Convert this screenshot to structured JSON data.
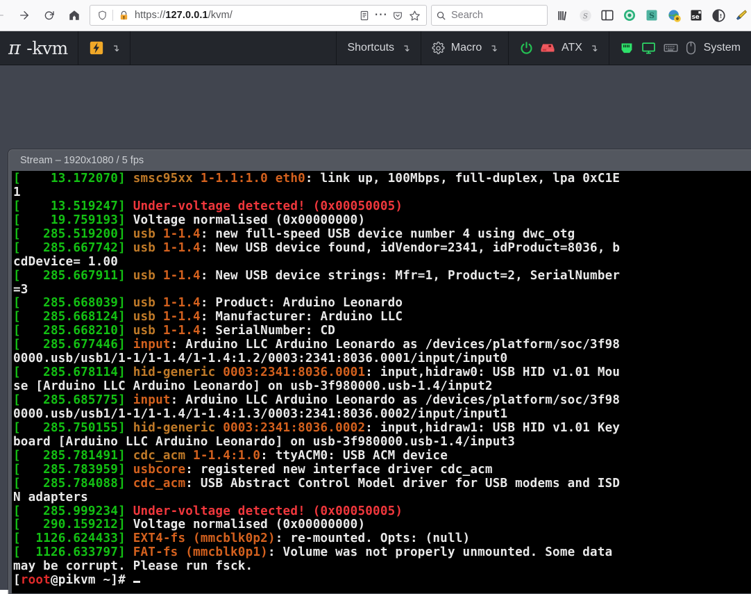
{
  "browser": {
    "nav": {
      "back_icon": "arrow-left-icon",
      "forward_icon": "arrow-right-icon",
      "reload_icon": "reload-icon",
      "home_icon": "home-icon"
    },
    "urlbar": {
      "shield_icon": "shield-icon",
      "lock_warning_icon": "lock-warning-icon",
      "url_prefix": "https://",
      "url_host": "127.0.0.1",
      "url_path": "/kvm/",
      "url_full": "https://127.0.0.1/kvm/",
      "reader_icon": "reader-view-icon",
      "page_actions_icon": "ellipsis-icon",
      "pocket_icon": "pocket-icon",
      "bookmark_icon": "star-icon"
    },
    "search": {
      "icon": "search-icon",
      "placeholder": "Search"
    },
    "extensions": [
      {
        "name": "library-icon",
        "label": ""
      },
      {
        "name": "sidebery-icon",
        "label": "S"
      },
      {
        "name": "sidebar-toggle-icon",
        "label": ""
      },
      {
        "name": "privacy-badger-icon",
        "label": ""
      },
      {
        "name": "stylus-icon",
        "label": "S"
      },
      {
        "name": "globe-extension-icon",
        "label": ""
      },
      {
        "name": "selenium-icon",
        "label": "se"
      },
      {
        "name": "noscript-icon",
        "label": ""
      },
      {
        "name": "highlighter-icon",
        "label": ""
      }
    ]
  },
  "pikvm": {
    "logo": {
      "pi": "π",
      "rest": "-kvm"
    },
    "menu": {
      "bolt": {
        "icon": "bolt-icon",
        "caret": "↴"
      },
      "shortcuts": {
        "label": "Shortcuts",
        "caret": "↴"
      },
      "macro": {
        "icon": "gear-icon",
        "label": "Macro",
        "caret": "↴"
      },
      "atx": {
        "power_icon": "power-icon",
        "hdd_icon": "hdd-icon",
        "label": "ATX",
        "caret": "↴"
      },
      "system": {
        "net_icon": "network-jack-icon",
        "video_icon": "monitor-icon",
        "keyboard_icon": "keyboard-icon",
        "mouse_icon": "mouse-icon",
        "label": "System"
      }
    },
    "colors": {
      "header_bg": "#23262c",
      "app_bg": "#41454f",
      "led_on": "#2ee06a",
      "led_off": "#7b7f86",
      "power_green": "#24c254",
      "hdd_red": "#f0585e"
    },
    "stream": {
      "title": "Stream – 1920x1080 / 5 fps",
      "resolution": "1920x1080",
      "fps": "5 fps"
    }
  },
  "terminal": {
    "lines": [
      [
        {
          "t": "[    13.172070] ",
          "c": "c-green"
        },
        {
          "t": "smsc95xx ",
          "c": "c-orange"
        },
        {
          "t": "1-1.1:1.0 eth0",
          "c": "c-amber"
        },
        {
          "t": ": link up, 100Mbps, full-duplex, lpa 0xC1E",
          "c": "c-white"
        }
      ],
      [
        {
          "t": "1",
          "c": "c-white"
        }
      ],
      [
        {
          "t": "[    13.519247] ",
          "c": "c-green"
        },
        {
          "t": "Under-voltage detected! (0x00050005)",
          "c": "c-red"
        }
      ],
      [
        {
          "t": "[    19.759193] ",
          "c": "c-green"
        },
        {
          "t": "Voltage normalised (0x00000000)",
          "c": "c-white"
        }
      ],
      [
        {
          "t": "[   285.519200] ",
          "c": "c-green"
        },
        {
          "t": "usb ",
          "c": "c-orange"
        },
        {
          "t": "1-1.4",
          "c": "c-amber"
        },
        {
          "t": ": new full-speed USB device number 4 using dwc_otg",
          "c": "c-white"
        }
      ],
      [
        {
          "t": "[   285.667742] ",
          "c": "c-green"
        },
        {
          "t": "usb ",
          "c": "c-orange"
        },
        {
          "t": "1-1.4",
          "c": "c-amber"
        },
        {
          "t": ": New USB device found, idVendor=2341, idProduct=8036, b",
          "c": "c-white"
        }
      ],
      [
        {
          "t": "cdDevice= 1.00",
          "c": "c-white"
        }
      ],
      [
        {
          "t": "[   285.667911] ",
          "c": "c-green"
        },
        {
          "t": "usb ",
          "c": "c-orange"
        },
        {
          "t": "1-1.4",
          "c": "c-amber"
        },
        {
          "t": ": New USB device strings: Mfr=1, Product=2, SerialNumber",
          "c": "c-white"
        }
      ],
      [
        {
          "t": "=3",
          "c": "c-white"
        }
      ],
      [
        {
          "t": "[   285.668039] ",
          "c": "c-green"
        },
        {
          "t": "usb ",
          "c": "c-orange"
        },
        {
          "t": "1-1.4",
          "c": "c-amber"
        },
        {
          "t": ": Product: Arduino Leonardo",
          "c": "c-white"
        }
      ],
      [
        {
          "t": "[   285.668124] ",
          "c": "c-green"
        },
        {
          "t": "usb ",
          "c": "c-orange"
        },
        {
          "t": "1-1.4",
          "c": "c-amber"
        },
        {
          "t": ": Manufacturer: Arduino LLC",
          "c": "c-white"
        }
      ],
      [
        {
          "t": "[   285.668210] ",
          "c": "c-green"
        },
        {
          "t": "usb ",
          "c": "c-orange"
        },
        {
          "t": "1-1.4",
          "c": "c-amber"
        },
        {
          "t": ": SerialNumber: CD",
          "c": "c-white"
        }
      ],
      [
        {
          "t": "[   285.677446] ",
          "c": "c-green"
        },
        {
          "t": "input",
          "c": "c-amber"
        },
        {
          "t": ": Arduino LLC Arduino Leonardo as /devices/platform/soc/3f98",
          "c": "c-white"
        }
      ],
      [
        {
          "t": "0000.usb/usb1/1-1/1-1.4/1-1.4:1.2/0003:2341:8036.0001/input/input0",
          "c": "c-white"
        }
      ],
      [
        {
          "t": "[   285.678114] ",
          "c": "c-green"
        },
        {
          "t": "hid-generic ",
          "c": "c-orange"
        },
        {
          "t": "0003:2341:8036.0001",
          "c": "c-amber"
        },
        {
          "t": ": input,hidraw0: USB HID v1.01 Mou",
          "c": "c-white"
        }
      ],
      [
        {
          "t": "se [Arduino LLC Arduino Leonardo] on usb-3f980000.usb-1.4/input2",
          "c": "c-white"
        }
      ],
      [
        {
          "t": "[   285.685775] ",
          "c": "c-green"
        },
        {
          "t": "input",
          "c": "c-amber"
        },
        {
          "t": ": Arduino LLC Arduino Leonardo as /devices/platform/soc/3f98",
          "c": "c-white"
        }
      ],
      [
        {
          "t": "0000.usb/usb1/1-1/1-1.4/1-1.4:1.3/0003:2341:8036.0002/input/input1",
          "c": "c-white"
        }
      ],
      [
        {
          "t": "[   285.750155] ",
          "c": "c-green"
        },
        {
          "t": "hid-generic ",
          "c": "c-orange"
        },
        {
          "t": "0003:2341:8036.0002",
          "c": "c-amber"
        },
        {
          "t": ": input,hidraw1: USB HID v1.01 Key",
          "c": "c-white"
        }
      ],
      [
        {
          "t": "board [Arduino LLC Arduino Leonardo] on usb-3f980000.usb-1.4/input3",
          "c": "c-white"
        }
      ],
      [
        {
          "t": "[   285.781491] ",
          "c": "c-green"
        },
        {
          "t": "cdc_acm ",
          "c": "c-orange"
        },
        {
          "t": "1-1.4:1.0",
          "c": "c-amber"
        },
        {
          "t": ": ttyACM0: USB ACM device",
          "c": "c-white"
        }
      ],
      [
        {
          "t": "[   285.783959] ",
          "c": "c-green"
        },
        {
          "t": "usbcore",
          "c": "c-amber"
        },
        {
          "t": ": registered new interface driver cdc_acm",
          "c": "c-white"
        }
      ],
      [
        {
          "t": "[   285.784088] ",
          "c": "c-green"
        },
        {
          "t": "cdc_acm",
          "c": "c-amber"
        },
        {
          "t": ": USB Abstract Control Model driver for USB modems and ISD",
          "c": "c-white"
        }
      ],
      [
        {
          "t": "N adapters",
          "c": "c-white"
        }
      ],
      [
        {
          "t": "[   285.999234] ",
          "c": "c-green"
        },
        {
          "t": "Under-voltage detected! (0x00050005)",
          "c": "c-red"
        }
      ],
      [
        {
          "t": "[   290.159212] ",
          "c": "c-green"
        },
        {
          "t": "Voltage normalised (0x00000000)",
          "c": "c-white"
        }
      ],
      [
        {
          "t": "[  1126.624433] ",
          "c": "c-green"
        },
        {
          "t": "EXT4-fs (mmcblk0p2)",
          "c": "c-amber"
        },
        {
          "t": ": re-mounted. Opts: (null)",
          "c": "c-white"
        }
      ],
      [
        {
          "t": "[  1126.633797] ",
          "c": "c-green"
        },
        {
          "t": "FAT-fs (mmcblk0p1)",
          "c": "c-amber"
        },
        {
          "t": ": Volume was not properly unmounted. Some data",
          "c": "c-white"
        }
      ],
      [
        {
          "t": "may be corrupt. Please run fsck.",
          "c": "c-white"
        }
      ],
      [
        {
          "t": "[",
          "c": "c-white"
        },
        {
          "t": "root",
          "c": "c-rootred"
        },
        {
          "t": "@pikvm ~]# ",
          "c": "c-white"
        },
        {
          "t": "█",
          "c": "c-cursor"
        }
      ]
    ]
  }
}
